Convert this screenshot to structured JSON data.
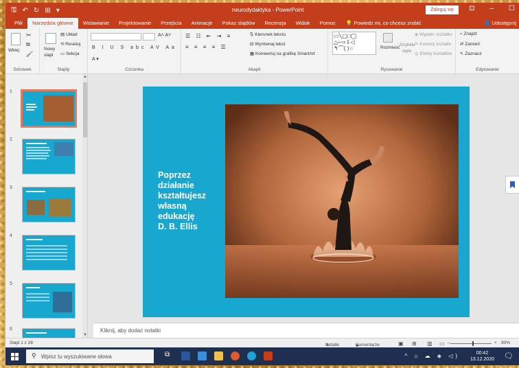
{
  "titlebar": {
    "doc_title": "neurodydaktyka - PowerPoint",
    "signin": "Zaloguj się"
  },
  "tabs": [
    "Plik",
    "Narzędzia główne",
    "Wstawianie",
    "Projektowanie",
    "Przejścia",
    "Animacje",
    "Pokaz slajdów",
    "Recenzja",
    "Widok",
    "Pomoc"
  ],
  "tellme": "Powiedz mi, co chcesz zrobić",
  "share": "Udostępnij",
  "ribbon": {
    "paste": "Wklej",
    "new_slide_1": "Nowy",
    "new_slide_2": "slajd",
    "layout": "Układ",
    "reset": "Resetuj",
    "section": "Sekcja",
    "text_direction": "Kierunek tekstu",
    "align_text": "Wyrównaj tekst",
    "smartart": "Konwertuj na grafikę SmartArt",
    "arrange": "Rozmieść",
    "quick_styles_1": "Szybkie",
    "quick_styles_2": "style",
    "shape_fill": "Wypełn. kształtu",
    "shape_outline": "Kontury kształtu",
    "shape_effects": "Efekty kształtów",
    "find": "Znajdź",
    "replace": "Zamień",
    "select": "Zaznacz",
    "groups": [
      "Schowek",
      "Slajdy",
      "Czcionka",
      "Akapit",
      "Rysowanie",
      "Edytowanie"
    ]
  },
  "thumbs": [
    "1",
    "2",
    "3",
    "4",
    "5",
    "6"
  ],
  "slide": {
    "text_lines": [
      "Poprzez",
      "działanie",
      "kształtujesz",
      "własną",
      "edukację",
      "D. B. Ellis"
    ]
  },
  "notes_placeholder": "Kliknij, aby dodać notatki",
  "status": {
    "slide_info": "Slajd 1 z 28",
    "notes": "Notatki",
    "comments": "Komentarze",
    "zoom": "90%"
  },
  "taskbar": {
    "search_placeholder": "Wpisz tu wyszukiwane słowa",
    "time": "00:42",
    "date": "13.12.2020"
  }
}
